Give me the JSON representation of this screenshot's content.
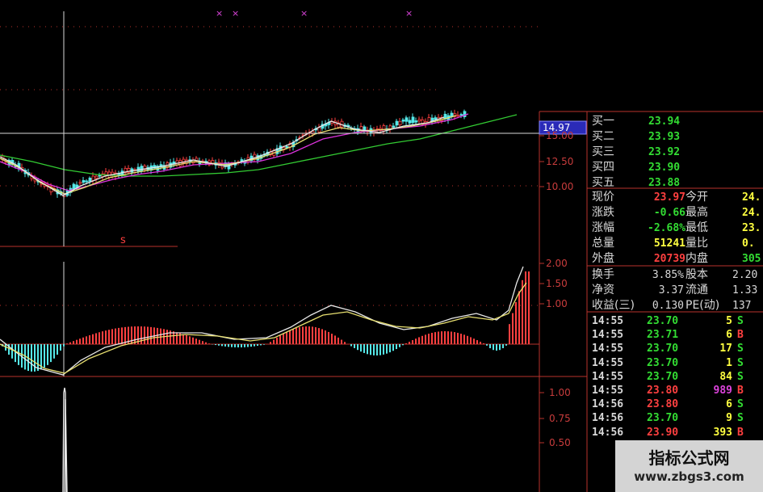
{
  "colors": {
    "grid": "#b8322d",
    "up": "#ff4040",
    "down": "#55e8e8",
    "green": "#33cc33",
    "white": "#e8e8e8",
    "yellow": "#e8e070",
    "magenta": "#dd33dd",
    "label": "#d8d8d8"
  },
  "top_markers": [
    "×",
    "×",
    "×",
    "×"
  ],
  "price_axis": {
    "crosshair": "14.97",
    "ticks": [
      "15.00",
      "12.50",
      "10.00"
    ]
  },
  "signal_label": "s",
  "macd_axis": {
    "ticks": [
      "2.00",
      "1.50",
      "1.00"
    ]
  },
  "volume_axis": {
    "ticks": [
      "1.00",
      "0.75",
      "0.50"
    ]
  },
  "bids": [
    {
      "label": "买一",
      "price": "23.94"
    },
    {
      "label": "买二",
      "price": "23.93"
    },
    {
      "label": "买三",
      "price": "23.92"
    },
    {
      "label": "买四",
      "price": "23.90"
    },
    {
      "label": "买五",
      "price": "23.88"
    }
  ],
  "quote": [
    {
      "l1": "现价",
      "v1": "23.97",
      "c1": "#ff4040",
      "l2": "今开",
      "v2": "24.",
      "c2": "#ffff40"
    },
    {
      "l1": "涨跌",
      "v1": "-0.66",
      "c1": "#33dd33",
      "l2": "最高",
      "v2": "24.",
      "c2": "#ffff40"
    },
    {
      "l1": "涨幅",
      "v1": "-2.68%",
      "c1": "#33dd33",
      "l2": "最低",
      "v2": "23.",
      "c2": "#ffff40"
    },
    {
      "l1": "总量",
      "v1": "51241",
      "c1": "#ffff40",
      "l2": "量比",
      "v2": "0.",
      "c2": "#ffff40"
    },
    {
      "l1": "外盘",
      "v1": "20739",
      "c1": "#ff4040",
      "l2": "内盘",
      "v2": "305",
      "c2": "#33dd33"
    }
  ],
  "fundamentals": [
    {
      "l1": "换手",
      "v1": "3.85%",
      "l2": "股本",
      "v2": "2.20"
    },
    {
      "l1": "净资",
      "v1": "3.37",
      "l2": "流通",
      "v2": "1.33"
    },
    {
      "l1": "收益(三)",
      "v1": "0.130",
      "l2": "PE(动)",
      "v2": "137"
    }
  ],
  "trades": [
    {
      "time": "14:55",
      "price": "23.70",
      "vol": "5",
      "side": "S"
    },
    {
      "time": "14:55",
      "price": "23.71",
      "vol": "6",
      "side": "B"
    },
    {
      "time": "14:55",
      "price": "23.70",
      "vol": "17",
      "side": "S"
    },
    {
      "time": "14:55",
      "price": "23.70",
      "vol": "1",
      "side": "S"
    },
    {
      "time": "14:55",
      "price": "23.70",
      "vol": "84",
      "side": "S"
    },
    {
      "time": "14:55",
      "price": "23.80",
      "vol": "989",
      "side": "B"
    },
    {
      "time": "14:56",
      "price": "23.80",
      "vol": "6",
      "side": "S"
    },
    {
      "time": "14:56",
      "price": "23.70",
      "vol": "9",
      "side": "S"
    },
    {
      "time": "14:56",
      "price": "23.90",
      "vol": "393",
      "side": "B"
    }
  ],
  "watermark": {
    "title": "指标公式网",
    "url": "www.zbgs3.com"
  }
}
